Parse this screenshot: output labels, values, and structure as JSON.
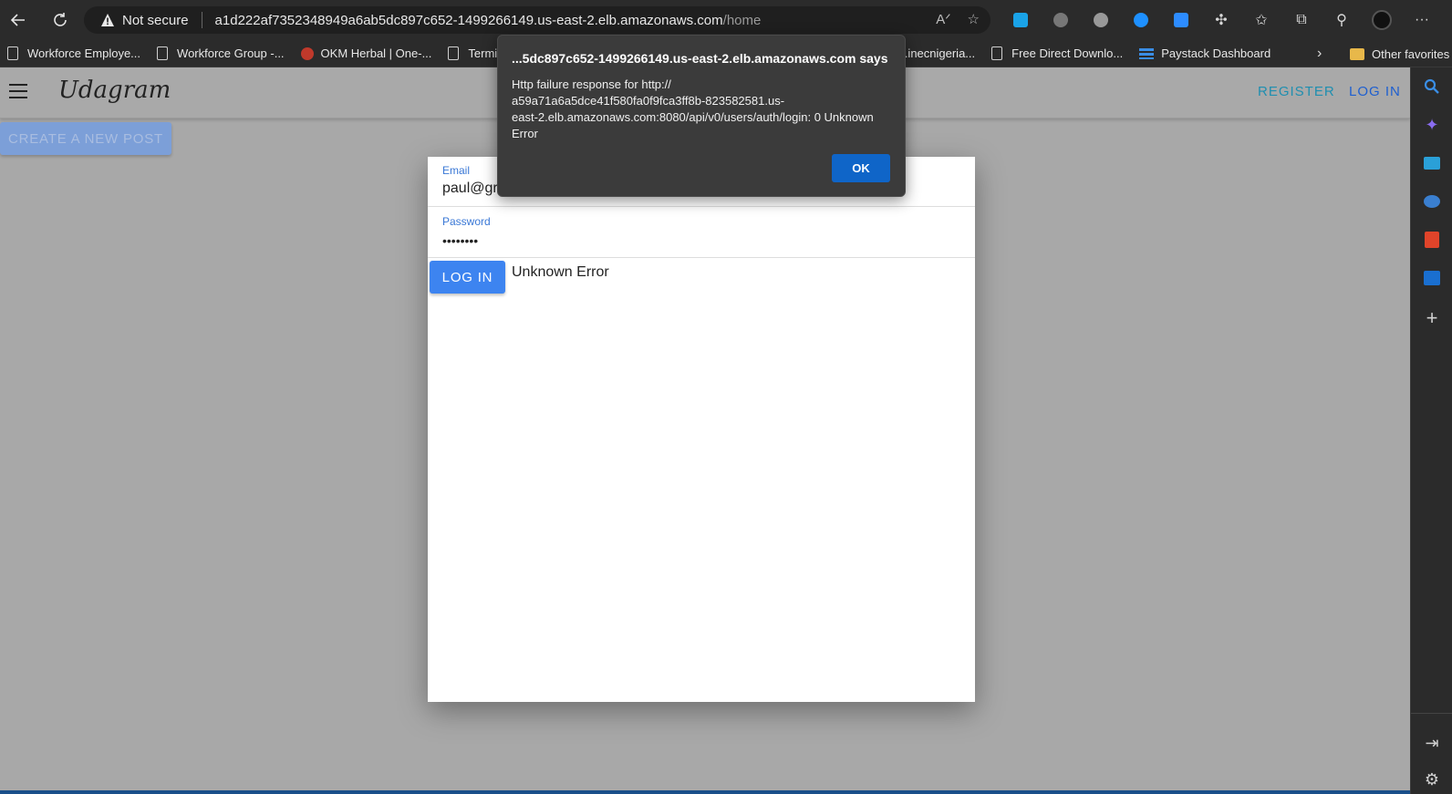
{
  "browser": {
    "security_label": "Not secure",
    "url_host": "a1d222af7352348949a6ab5dc897c652-1499266149.us-east-2.elb.amazonaws.com",
    "url_path": "/home"
  },
  "bookmarks": {
    "items": [
      {
        "label": "Workforce Employe..."
      },
      {
        "label": "Workforce Group -..."
      },
      {
        "label": "OKM Herbal | One-..."
      },
      {
        "label": "Termii - Ret"
      },
      {
        "label": "terreg.inecnigeria..."
      },
      {
        "label": "Free Direct Downlo..."
      },
      {
        "label": "Paystack Dashboard"
      }
    ],
    "other": "Other favorites"
  },
  "app": {
    "brand": "Udagram",
    "register_label": "REGISTER",
    "login_label": "LOG IN",
    "create_label": "CREATE A NEW POST",
    "colors": {
      "register": "#1f8fb0",
      "login": "#1e5fd0"
    }
  },
  "form": {
    "email_label": "Email",
    "email_value": "paul@gr",
    "password_label": "Password",
    "password_value": "••••••••",
    "submit_label": "LOG IN",
    "error_text": "Unknown Error"
  },
  "dialog": {
    "title": "...5dc897c652-1499266149.us-east-2.elb.amazonaws.com says",
    "message_lines": [
      "Http failure response for http://",
      "a59a71a6a5dce41f580fa0f9fca3ff8b-823582581.us-",
      "east-2.elb.amazonaws.com:8080/api/v0/users/auth/login: 0 Unknown",
      "Error"
    ],
    "ok_label": "OK"
  }
}
